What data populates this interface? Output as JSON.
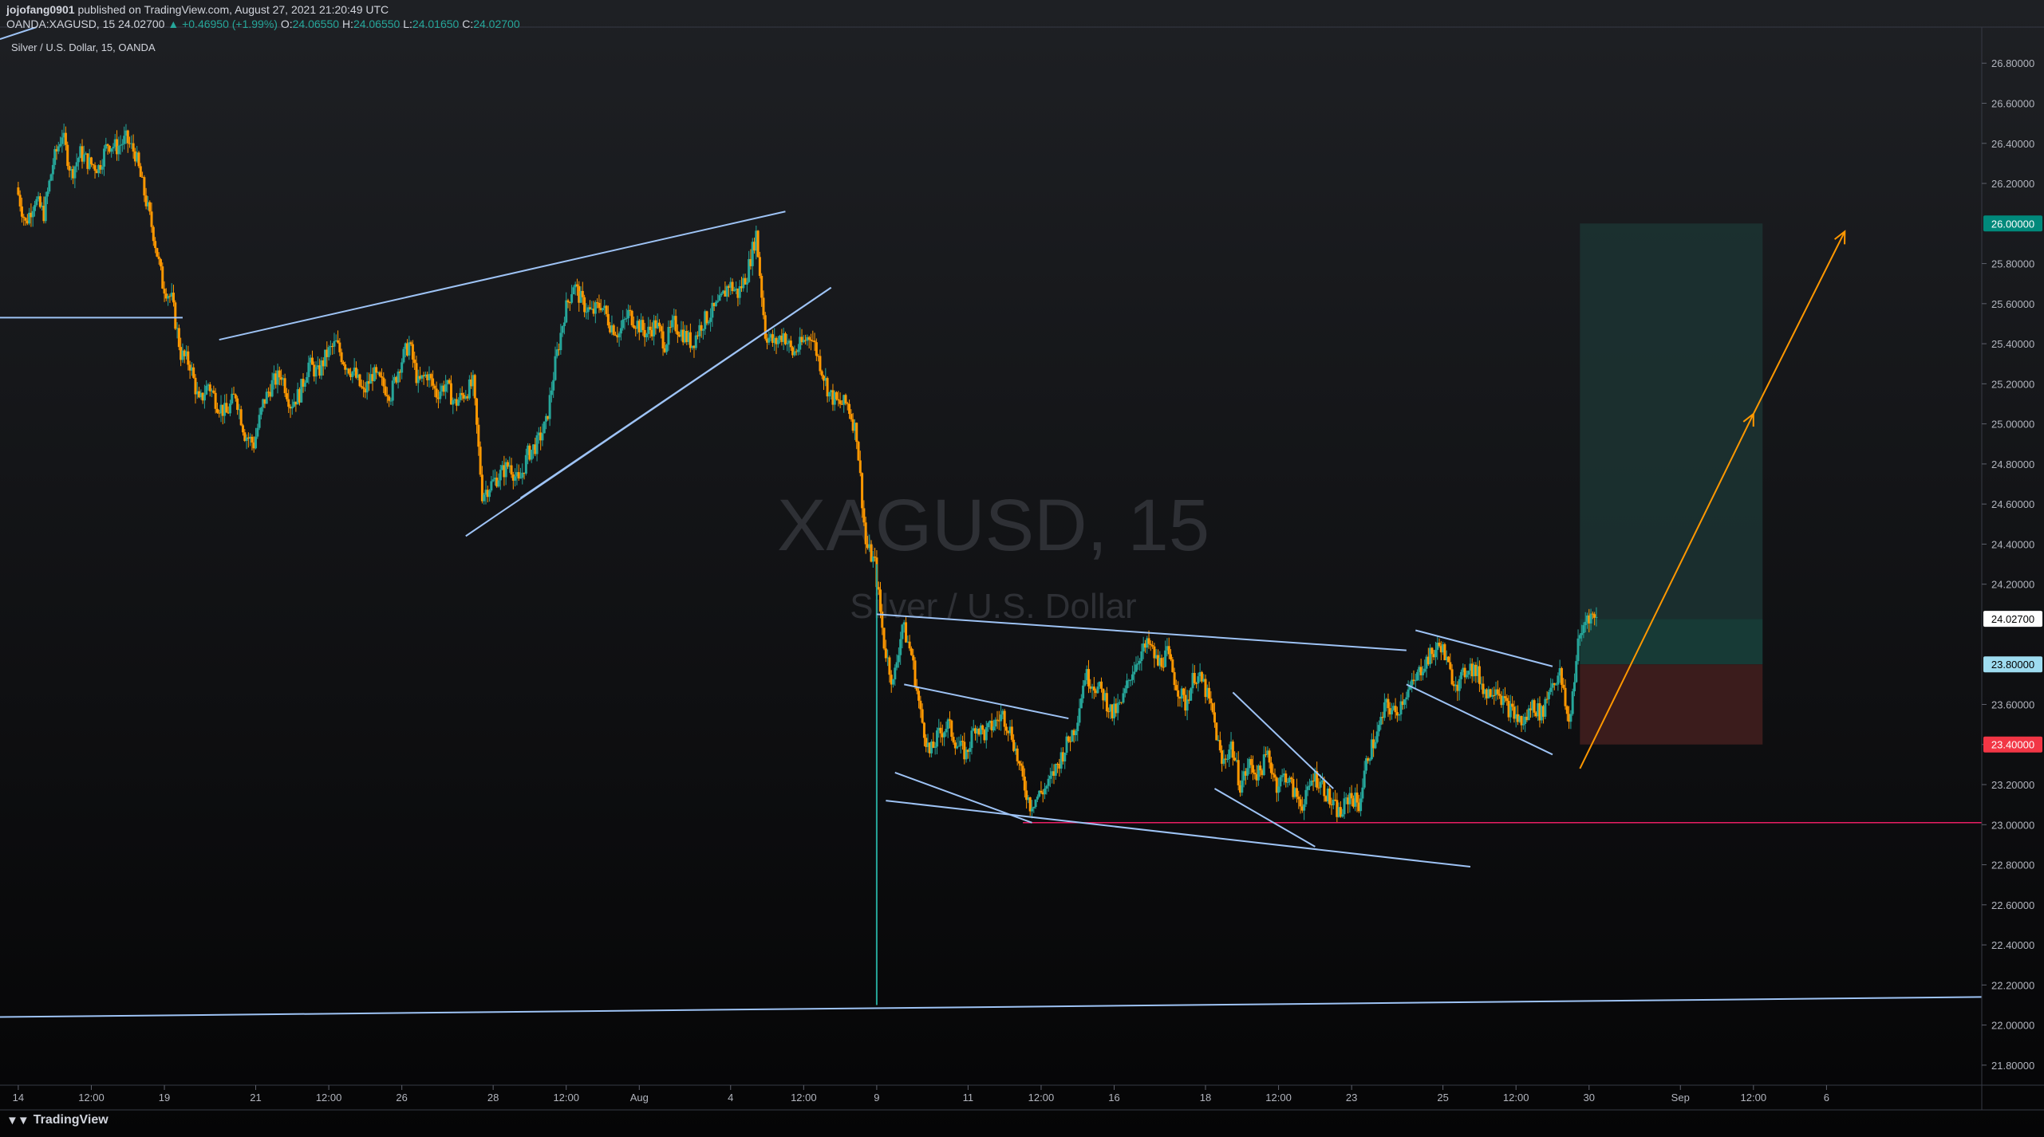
{
  "header": {
    "publisher": "jojofang0901",
    "published_text": "published on TradingView.com, August 27, 2021 21:20:49 UTC",
    "symbol_line_prefix": "OANDA:XAGUSD, 15",
    "last_price": "24.02700",
    "change": "▲ +0.46950 (+1.99%)",
    "o_label": "O:",
    "o_value": "24.06550",
    "h_label": "H:",
    "h_value": "24.06550",
    "l_label": "L:",
    "l_value": "24.01650",
    "c_label": "C:",
    "c_value": "24.02700"
  },
  "legend": {
    "text": "Silver / U.S. Dollar, 15, OANDA"
  },
  "watermark": {
    "symbol": "XAGUSD, 15",
    "description": "Silver / U.S. Dollar"
  },
  "footer": {
    "brand": "TradingView",
    "logo_icon": "tradingview-logo-icon"
  },
  "colors": {
    "background": "#000000",
    "trendline": "#9ec3f5",
    "support_line": "#e91e63",
    "arrow": "#ff9800",
    "candle_up": "#26a69a",
    "candle_down": "#ff9800",
    "target_zone": "#1c3432",
    "profit_zone": "#173a36",
    "stop_zone": "#3b1c1c",
    "label_target": "#00897b",
    "label_entry": "#9edcf0",
    "label_stop": "#f23645",
    "label_last": "#ffffff"
  },
  "chart_data": {
    "type": "candlestick",
    "title": "Silver / U.S. Dollar, 15, OANDA",
    "ylim": [
      21.7,
      26.98
    ],
    "y_ticks": [
      "26.80000",
      "26.60000",
      "26.40000",
      "26.20000",
      "25.80000",
      "25.60000",
      "25.40000",
      "25.20000",
      "25.00000",
      "24.80000",
      "24.60000",
      "24.40000",
      "24.20000",
      "23.60000",
      "23.40000",
      "23.20000",
      "23.00000",
      "22.80000",
      "22.60000",
      "22.40000",
      "22.20000",
      "22.00000",
      "21.80000"
    ],
    "y_tick_values": [
      26.8,
      26.6,
      26.4,
      26.2,
      25.8,
      25.6,
      25.4,
      25.2,
      25.0,
      24.8,
      24.6,
      24.4,
      24.2,
      23.6,
      23.4,
      23.2,
      23.0,
      22.8,
      22.6,
      22.4,
      22.2,
      22.0,
      21.8
    ],
    "x_ticks": [
      "14",
      "12:00",
      "19",
      "21",
      "12:00",
      "26",
      "28",
      "12:00",
      "Aug",
      "4",
      "12:00",
      "9",
      "11",
      "12:00",
      "16",
      "18",
      "12:00",
      "23",
      "25",
      "12:00",
      "30",
      "Sep",
      "12:00",
      "6"
    ],
    "x_tick_pos": [
      0,
      8,
      16,
      26,
      34,
      42,
      52,
      60,
      68,
      78,
      86,
      94,
      104,
      112,
      120,
      130,
      138,
      146,
      156,
      164,
      172,
      182,
      190,
      198
    ],
    "x_range": [
      -2,
      215
    ],
    "price_path": [
      [
        0,
        26.18
      ],
      [
        1,
        26.0
      ],
      [
        2,
        26.12
      ],
      [
        3,
        26.05
      ],
      [
        4,
        26.3
      ],
      [
        5,
        26.45
      ],
      [
        6,
        26.25
      ],
      [
        7,
        26.35
      ],
      [
        8,
        26.3
      ],
      [
        9,
        26.28
      ],
      [
        10,
        26.4
      ],
      [
        11,
        26.38
      ],
      [
        12,
        26.42
      ],
      [
        13,
        26.35
      ],
      [
        14,
        26.15
      ],
      [
        15,
        25.95
      ],
      [
        16,
        25.7
      ],
      [
        17,
        25.62
      ],
      [
        18,
        25.35
      ],
      [
        19,
        25.3
      ],
      [
        20,
        25.1
      ],
      [
        21,
        25.2
      ],
      [
        22,
        25.1
      ],
      [
        23,
        25.05
      ],
      [
        24,
        25.15
      ],
      [
        25,
        24.95
      ],
      [
        26,
        24.9
      ],
      [
        27,
        25.1
      ],
      [
        28,
        25.2
      ],
      [
        29,
        25.25
      ],
      [
        30,
        25.1
      ],
      [
        31,
        25.15
      ],
      [
        32,
        25.3
      ],
      [
        33,
        25.25
      ],
      [
        34,
        25.35
      ],
      [
        35,
        25.4
      ],
      [
        36,
        25.3
      ],
      [
        37,
        25.25
      ],
      [
        38,
        25.15
      ],
      [
        39,
        25.25
      ],
      [
        40,
        25.2
      ],
      [
        41,
        25.15
      ],
      [
        42,
        25.3
      ],
      [
        43,
        25.4
      ],
      [
        44,
        25.2
      ],
      [
        45,
        25.25
      ],
      [
        46,
        25.15
      ],
      [
        47,
        25.2
      ],
      [
        48,
        25.1
      ],
      [
        49,
        25.15
      ],
      [
        50,
        25.2
      ],
      [
        51,
        24.65
      ],
      [
        52,
        24.7
      ],
      [
        53,
        24.75
      ],
      [
        54,
        24.8
      ],
      [
        55,
        24.7
      ],
      [
        56,
        24.85
      ],
      [
        57,
        24.9
      ],
      [
        58,
        25.0
      ],
      [
        59,
        25.3
      ],
      [
        60,
        25.55
      ],
      [
        61,
        25.7
      ],
      [
        62,
        25.6
      ],
      [
        63,
        25.55
      ],
      [
        64,
        25.6
      ],
      [
        65,
        25.5
      ],
      [
        66,
        25.45
      ],
      [
        67,
        25.55
      ],
      [
        68,
        25.5
      ],
      [
        69,
        25.45
      ],
      [
        70,
        25.5
      ],
      [
        71,
        25.4
      ],
      [
        72,
        25.5
      ],
      [
        73,
        25.45
      ],
      [
        74,
        25.4
      ],
      [
        75,
        25.5
      ],
      [
        76,
        25.55
      ],
      [
        77,
        25.6
      ],
      [
        78,
        25.7
      ],
      [
        79,
        25.65
      ],
      [
        80,
        25.75
      ],
      [
        81,
        25.95
      ],
      [
        82,
        25.45
      ],
      [
        83,
        25.4
      ],
      [
        84,
        25.45
      ],
      [
        85,
        25.35
      ],
      [
        86,
        25.4
      ],
      [
        87,
        25.45
      ],
      [
        88,
        25.3
      ],
      [
        89,
        25.15
      ],
      [
        90,
        25.1
      ],
      [
        91,
        25.1
      ],
      [
        92,
        24.95
      ],
      [
        93,
        24.4
      ],
      [
        94,
        24.3
      ],
      [
        95,
        23.9
      ],
      [
        96,
        23.7
      ],
      [
        97,
        24.0
      ],
      [
        98,
        23.85
      ],
      [
        99,
        23.55
      ],
      [
        100,
        23.35
      ],
      [
        101,
        23.45
      ],
      [
        102,
        23.5
      ],
      [
        103,
        23.4
      ],
      [
        104,
        23.35
      ],
      [
        105,
        23.5
      ],
      [
        106,
        23.45
      ],
      [
        107,
        23.5
      ],
      [
        108,
        23.55
      ],
      [
        109,
        23.45
      ],
      [
        110,
        23.25
      ],
      [
        111,
        23.1
      ],
      [
        112,
        23.15
      ],
      [
        113,
        23.2
      ],
      [
        114,
        23.3
      ],
      [
        115,
        23.4
      ],
      [
        116,
        23.5
      ],
      [
        117,
        23.75
      ],
      [
        118,
        23.7
      ],
      [
        119,
        23.65
      ],
      [
        120,
        23.55
      ],
      [
        121,
        23.6
      ],
      [
        122,
        23.75
      ],
      [
        123,
        23.85
      ],
      [
        124,
        23.9
      ],
      [
        125,
        23.8
      ],
      [
        126,
        23.85
      ],
      [
        127,
        23.7
      ],
      [
        128,
        23.6
      ],
      [
        129,
        23.75
      ],
      [
        130,
        23.7
      ],
      [
        131,
        23.55
      ],
      [
        132,
        23.3
      ],
      [
        133,
        23.4
      ],
      [
        134,
        23.2
      ],
      [
        135,
        23.3
      ],
      [
        136,
        23.25
      ],
      [
        137,
        23.35
      ],
      [
        138,
        23.2
      ],
      [
        139,
        23.25
      ],
      [
        140,
        23.15
      ],
      [
        141,
        23.1
      ],
      [
        142,
        23.25
      ],
      [
        143,
        23.2
      ],
      [
        144,
        23.1
      ],
      [
        145,
        23.05
      ],
      [
        146,
        23.15
      ],
      [
        147,
        23.1
      ],
      [
        148,
        23.35
      ],
      [
        149,
        23.45
      ],
      [
        150,
        23.6
      ],
      [
        151,
        23.55
      ],
      [
        152,
        23.65
      ],
      [
        153,
        23.7
      ],
      [
        154,
        23.8
      ],
      [
        155,
        23.85
      ],
      [
        156,
        23.9
      ],
      [
        157,
        23.75
      ],
      [
        158,
        23.7
      ],
      [
        159,
        23.8
      ],
      [
        160,
        23.75
      ],
      [
        161,
        23.65
      ],
      [
        162,
        23.7
      ],
      [
        163,
        23.6
      ],
      [
        164,
        23.55
      ],
      [
        165,
        23.5
      ],
      [
        166,
        23.6
      ],
      [
        167,
        23.55
      ],
      [
        168,
        23.7
      ],
      [
        169,
        23.75
      ],
      [
        170,
        23.5
      ],
      [
        171,
        23.9
      ],
      [
        172,
        24.05
      ],
      [
        173,
        24.03
      ]
    ],
    "spike_low": {
      "x": 94,
      "value": 22.1
    },
    "position": {
      "type": "long",
      "entry": 23.8,
      "target": 26.0,
      "stop": 23.4,
      "x_start": 171,
      "x_end": 191
    },
    "price_labels": [
      {
        "value": 26.0,
        "text": "26.00000",
        "kind": "target"
      },
      {
        "value": 24.027,
        "text": "24.02700",
        "kind": "last"
      },
      {
        "value": 23.8,
        "text": "23.80000",
        "kind": "entry"
      },
      {
        "value": 23.4,
        "text": "23.40000",
        "kind": "stop"
      }
    ],
    "support_level": {
      "value": 23.01,
      "x_start": 110,
      "x_end": 215
    },
    "drawings": [
      {
        "name": "top-left-trendline",
        "points": [
          [
            -2,
            26.92
          ],
          [
            2,
            26.98
          ]
        ]
      },
      {
        "name": "left-horizontal-line",
        "points": [
          [
            -2,
            25.53
          ],
          [
            18,
            25.53
          ]
        ]
      },
      {
        "name": "upper-resistance-line",
        "points": [
          [
            22,
            25.42
          ],
          [
            84,
            26.06
          ]
        ]
      },
      {
        "name": "rising-wedge-upper",
        "points": [
          [
            49,
            24.44
          ],
          [
            89,
            25.68
          ]
        ]
      },
      {
        "name": "rising-wedge-lower",
        "points": [
          [
            55,
            24.63
          ],
          [
            89,
            25.68
          ]
        ]
      },
      {
        "name": "bottom-support-trendline",
        "points": [
          [
            -2,
            22.04
          ],
          [
            215,
            22.14
          ]
        ]
      },
      {
        "name": "descending-channel-top",
        "points": [
          [
            94,
            24.05
          ],
          [
            152,
            23.87
          ]
        ]
      },
      {
        "name": "descending-channel-bottom",
        "points": [
          [
            95,
            23.12
          ],
          [
            159,
            22.79
          ]
        ]
      },
      {
        "name": "small-flag-top",
        "points": [
          [
            97,
            23.7
          ],
          [
            115,
            23.53
          ]
        ]
      },
      {
        "name": "small-flag-bottom",
        "points": [
          [
            96,
            23.26
          ],
          [
            111,
            23.01
          ]
        ]
      },
      {
        "name": "wedge-right-top",
        "points": [
          [
            133,
            23.66
          ],
          [
            144,
            23.18
          ]
        ]
      },
      {
        "name": "wedge-right-bottom",
        "points": [
          [
            131,
            23.18
          ],
          [
            142,
            22.89
          ]
        ]
      },
      {
        "name": "bull-flag-top",
        "points": [
          [
            153,
            23.97
          ],
          [
            168,
            23.79
          ]
        ]
      },
      {
        "name": "bull-flag-bottom",
        "points": [
          [
            152,
            23.7
          ],
          [
            168,
            23.35
          ]
        ]
      },
      {
        "name": "flag-join-line",
        "points": [
          [
            168,
            23.79
          ],
          [
            168,
            23.79
          ]
        ]
      }
    ],
    "projection_arrows": [
      {
        "name": "projection-arrow-lower",
        "points": [
          [
            171,
            23.28
          ],
          [
            190,
            25.05
          ]
        ]
      },
      {
        "name": "projection-arrow-upper",
        "points": [
          [
            190,
            25.05
          ],
          [
            200,
            25.96
          ]
        ]
      }
    ]
  }
}
